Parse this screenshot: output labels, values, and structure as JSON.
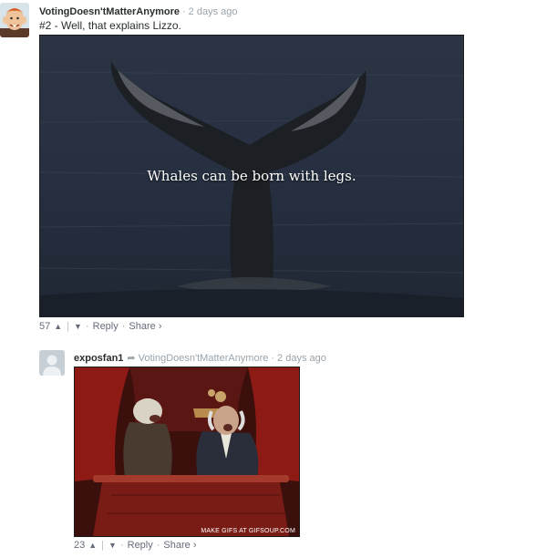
{
  "comments": [
    {
      "author": "VotingDoesn'tMatterAnymore",
      "time": "2 days ago",
      "text": "#2 - Well, that explains Lizzo.",
      "media_caption": "Whales can be born with legs.",
      "votes": "57",
      "reply_label": "Reply",
      "share_label": "Share ›"
    },
    {
      "author": "exposfan1",
      "reply_to": "VotingDoesn'tMatterAnymore",
      "time": "2 days ago",
      "media_watermark": "MAKE GIFS AT GIFSOUP.COM",
      "votes": "23",
      "reply_label": "Reply",
      "share_label": "Share ›"
    }
  ],
  "icons": {
    "upvote": "▲",
    "downvote": "▼",
    "reply_arrow": "➦"
  }
}
